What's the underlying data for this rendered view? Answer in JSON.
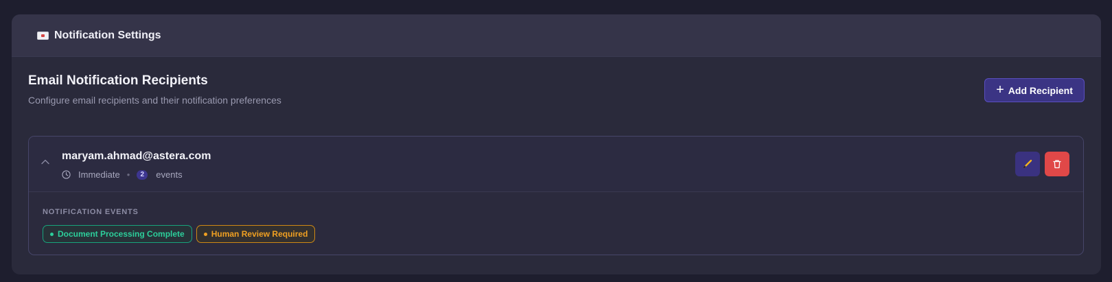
{
  "header": {
    "icon": "envelope-icon",
    "title": "Notification Settings"
  },
  "section": {
    "title": "Email Notification Recipients",
    "subtitle": "Configure email recipients and their notification preferences",
    "add_button": "Add Recipient"
  },
  "recipients": [
    {
      "email": "maryam.ahmad@astera.com",
      "frequency": "Immediate",
      "separator": "•",
      "event_count": "2",
      "events_word": "events",
      "events_label": "NOTIFICATION EVENTS",
      "events": [
        {
          "label": "Document Processing Complete",
          "color": "#2ccf9b"
        },
        {
          "label": "Human Review Required",
          "color": "#f0a022"
        }
      ]
    }
  ],
  "colors": {
    "accent": "#3b3484",
    "delete": "#e04848",
    "background": "#1e1e2e"
  }
}
